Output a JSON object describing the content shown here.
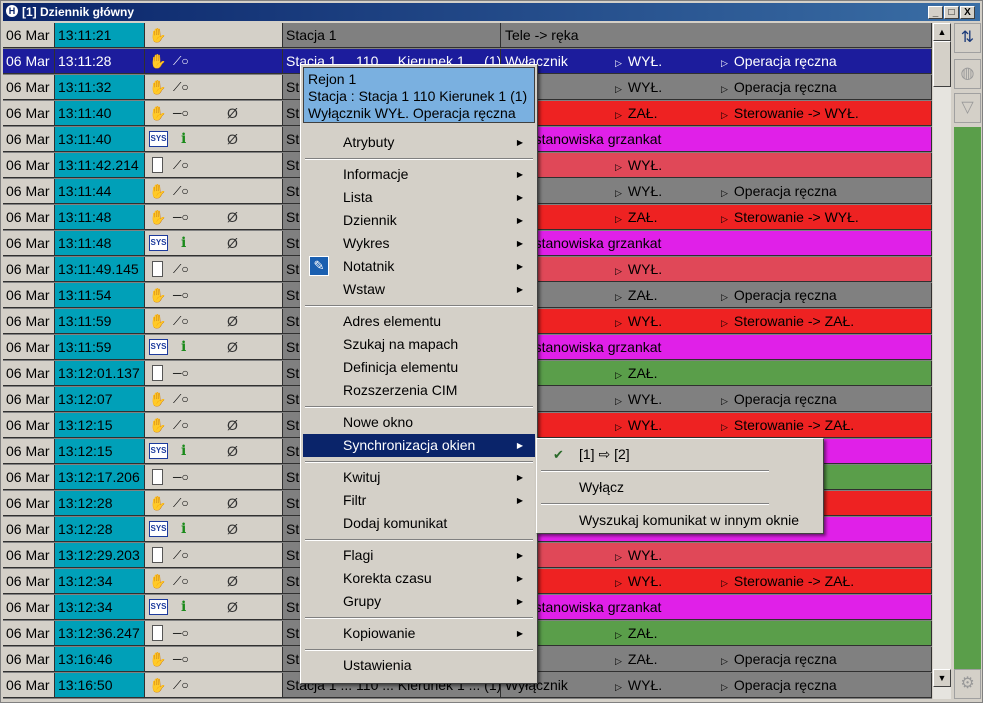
{
  "window": {
    "title": "[1] Dziennik główny"
  },
  "colors": {
    "grey": "#808080",
    "red": "#ee2222",
    "pink": "#e04858",
    "magenta": "#e020e8",
    "green": "#5a9e4a",
    "selected": "#1c1c9c",
    "time_cyan": "#00a0b8"
  },
  "rows": [
    {
      "date": "06 Mar",
      "time": "13:11:21",
      "icons": [
        "hand-icon"
      ],
      "station": "Stacja 1",
      "desc_a": "Tele -> ręka",
      "desc_b": "",
      "desc_c": "",
      "color": "grey"
    },
    {
      "date": "06 Mar",
      "time": "13:11:28",
      "icons": [
        "hand-icon",
        "switch-off-icon"
      ],
      "station": "Stacja 1 ... 110 ... Kierunek 1 ... (1)",
      "desc_a": "Wyłącznik",
      "desc_b": "WYŁ.",
      "desc_c": "Operacja ręczna",
      "color": "selected"
    },
    {
      "date": "06 Mar",
      "time": "13:11:32",
      "icons": [
        "hand-icon",
        "switch-off-icon"
      ],
      "station": "St",
      "desc_a": "cznik",
      "desc_b": "WYŁ.",
      "desc_c": "Operacja ręczna",
      "color": "grey"
    },
    {
      "date": "06 Mar",
      "time": "13:11:40",
      "icons": [
        "fire-hand-icon",
        "switch-on-icon",
        "clip-icon"
      ],
      "station": "St",
      "desc_a": "cznik",
      "desc_b": "ZAŁ.",
      "desc_c": "Sterowanie -> WYŁ.",
      "color": "red"
    },
    {
      "date": "06 Mar",
      "time": "13:11:40",
      "icons": [
        "sys-icon",
        "info-icon",
        "clip-icon"
      ],
      "station": "St",
      "desc_a": "s ze stanowiska grzankat",
      "desc_b": "",
      "desc_c": "",
      "color": "magenta"
    },
    {
      "date": "06 Mar",
      "time": "13:11:42.214",
      "icons": [
        "doc-icon",
        "switch-off-icon"
      ],
      "station": "St",
      "desc_a": "cznik",
      "desc_b": "WYŁ.",
      "desc_c": "",
      "color": "pink"
    },
    {
      "date": "06 Mar",
      "time": "13:11:44",
      "icons": [
        "hand-icon",
        "switch-off-icon"
      ],
      "station": "St",
      "desc_a": "cznik",
      "desc_b": "WYŁ.",
      "desc_c": "Operacja ręczna",
      "color": "grey"
    },
    {
      "date": "06 Mar",
      "time": "13:11:48",
      "icons": [
        "fire-hand-icon",
        "switch-on-icon",
        "clip-icon"
      ],
      "station": "St",
      "desc_a": "cznik",
      "desc_b": "ZAŁ.",
      "desc_c": "Sterowanie -> WYŁ.",
      "color": "red"
    },
    {
      "date": "06 Mar",
      "time": "13:11:48",
      "icons": [
        "sys-icon",
        "info-icon",
        "clip-icon"
      ],
      "station": "St",
      "desc_a": "s ze stanowiska grzankat",
      "desc_b": "",
      "desc_c": "",
      "color": "magenta"
    },
    {
      "date": "06 Mar",
      "time": "13:11:49.145",
      "icons": [
        "doc-icon",
        "switch-off-icon"
      ],
      "station": "St",
      "desc_a": "cznik",
      "desc_b": "WYŁ.",
      "desc_c": "",
      "color": "pink"
    },
    {
      "date": "06 Mar",
      "time": "13:11:54",
      "icons": [
        "hand-icon",
        "switch-on-icon"
      ],
      "station": "St",
      "desc_a": "cznik",
      "desc_b": "ZAŁ.",
      "desc_c": "Operacja ręczna",
      "color": "grey"
    },
    {
      "date": "06 Mar",
      "time": "13:11:59",
      "icons": [
        "fire-hand-icon",
        "switch-off-icon",
        "clip-icon"
      ],
      "station": "St",
      "desc_a": "cznik",
      "desc_b": "WYŁ.",
      "desc_c": "Sterowanie -> ZAŁ.",
      "color": "red"
    },
    {
      "date": "06 Mar",
      "time": "13:11:59",
      "icons": [
        "sys-icon",
        "info-icon",
        "clip-icon"
      ],
      "station": "St",
      "desc_a": "s ze stanowiska grzankat",
      "desc_b": "",
      "desc_c": "",
      "color": "magenta"
    },
    {
      "date": "06 Mar",
      "time": "13:12:01.137",
      "icons": [
        "doc-icon",
        "switch-on-icon"
      ],
      "station": "St",
      "desc_a": "cznik",
      "desc_b": "ZAŁ.",
      "desc_c": "",
      "color": "green"
    },
    {
      "date": "06 Mar",
      "time": "13:12:07",
      "icons": [
        "hand-icon",
        "switch-off-icon"
      ],
      "station": "St",
      "desc_a": "cznik",
      "desc_b": "WYŁ.",
      "desc_c": "Operacja ręczna",
      "color": "grey"
    },
    {
      "date": "06 Mar",
      "time": "13:12:15",
      "icons": [
        "fire-hand-icon",
        "switch-off-icon",
        "clip-icon"
      ],
      "station": "St",
      "desc_a": "cznik",
      "desc_b": "WYŁ.",
      "desc_c": "Sterowanie -> ZAŁ.",
      "color": "red"
    },
    {
      "date": "06 Mar",
      "time": "13:12:15",
      "icons": [
        "sys-icon",
        "info-icon",
        "clip-icon"
      ],
      "station": "St",
      "desc_a": "",
      "desc_b": "",
      "desc_c": "",
      "color": "magenta"
    },
    {
      "date": "06 Mar",
      "time": "13:12:17.206",
      "icons": [
        "doc-icon",
        "switch-on-icon"
      ],
      "station": "St",
      "desc_a": "",
      "desc_b": "",
      "desc_c": "",
      "color": "green"
    },
    {
      "date": "06 Mar",
      "time": "13:12:28",
      "icons": [
        "fire-hand-icon",
        "switch-off-icon",
        "clip-icon"
      ],
      "station": "St",
      "desc_a": "",
      "desc_b": "",
      "desc_c": "WYŁ.",
      "color": "red"
    },
    {
      "date": "06 Mar",
      "time": "13:12:28",
      "icons": [
        "sys-icon",
        "info-icon",
        "clip-icon"
      ],
      "station": "St",
      "desc_a": "",
      "desc_b": "",
      "desc_c": "",
      "color": "magenta"
    },
    {
      "date": "06 Mar",
      "time": "13:12:29.203",
      "icons": [
        "doc-icon",
        "switch-off-icon"
      ],
      "station": "St",
      "desc_a": "cznik",
      "desc_b": "WYŁ.",
      "desc_c": "",
      "color": "pink"
    },
    {
      "date": "06 Mar",
      "time": "13:12:34",
      "icons": [
        "fire-hand-icon",
        "switch-off-icon",
        "clip-icon"
      ],
      "station": "St",
      "desc_a": "cznik",
      "desc_b": "WYŁ.",
      "desc_c": "Sterowanie -> ZAŁ.",
      "color": "red"
    },
    {
      "date": "06 Mar",
      "time": "13:12:34",
      "icons": [
        "sys-icon",
        "info-icon",
        "clip-icon"
      ],
      "station": "St",
      "desc_a": "s ze stanowiska grzankat",
      "desc_b": "",
      "desc_c": "",
      "color": "magenta"
    },
    {
      "date": "06 Mar",
      "time": "13:12:36.247",
      "icons": [
        "doc-icon",
        "switch-on-icon"
      ],
      "station": "St",
      "desc_a": "cznik",
      "desc_b": "ZAŁ.",
      "desc_c": "",
      "color": "green"
    },
    {
      "date": "06 Mar",
      "time": "13:16:46",
      "icons": [
        "hand-icon",
        "switch-on-icon"
      ],
      "station": "St",
      "desc_a": "cznik",
      "desc_b": "ZAŁ.",
      "desc_c": "Operacja ręczna",
      "color": "grey"
    },
    {
      "date": "06 Mar",
      "time": "13:16:50",
      "icons": [
        "hand-icon",
        "switch-off-icon"
      ],
      "station": "Stacja 1 ... 110 ... Kierunek 1 ... (1)",
      "desc_a": "Wyłącznik",
      "desc_b": "WYŁ.",
      "desc_c": "Operacja ręczna",
      "color": "grey"
    }
  ],
  "context_menu": {
    "header": [
      "Rejon 1",
      "Stacja : Stacja 1 110 Kierunek 1 (1)",
      "Wyłącznik WYŁ. Operacja ręczna"
    ],
    "items": [
      {
        "label": "Atrybuty",
        "submenu": true
      },
      {
        "sep": true
      },
      {
        "label": "Informacje",
        "submenu": true
      },
      {
        "label": "Lista",
        "submenu": true
      },
      {
        "label": "Dziennik",
        "submenu": true
      },
      {
        "label": "Wykres",
        "submenu": true
      },
      {
        "label": "Notatnik",
        "submenu": true,
        "icon": "pencil-icon"
      },
      {
        "label": "Wstaw",
        "submenu": true
      },
      {
        "sep": true
      },
      {
        "label": "Adres elementu"
      },
      {
        "label": "Szukaj na mapach"
      },
      {
        "label": "Definicja elementu"
      },
      {
        "label": "Rozszerzenia CIM"
      },
      {
        "sep": true
      },
      {
        "label": "Nowe okno"
      },
      {
        "label": "Synchronizacja okien",
        "submenu": true,
        "highlighted": true
      },
      {
        "sep": true
      },
      {
        "label": "Kwituj",
        "submenu": true
      },
      {
        "label": "Filtr",
        "submenu": true
      },
      {
        "label": "Dodaj komunikat"
      },
      {
        "sep": true
      },
      {
        "label": "Flagi",
        "submenu": true
      },
      {
        "label": "Korekta czasu",
        "submenu": true
      },
      {
        "label": "Grupy",
        "submenu": true
      },
      {
        "sep": true
      },
      {
        "label": "Kopiowanie",
        "submenu": true
      },
      {
        "sep": true
      },
      {
        "label": "Ustawienia"
      }
    ]
  },
  "sync_submenu": {
    "items": [
      {
        "label": "[1] ⇨ [2]",
        "checked": true
      },
      {
        "sep": true
      },
      {
        "label": "Wyłącz"
      },
      {
        "sep": true
      },
      {
        "label": "Wyszukaj komunikat w innym oknie"
      }
    ]
  },
  "title_buttons": [
    "_",
    "□",
    "X"
  ]
}
